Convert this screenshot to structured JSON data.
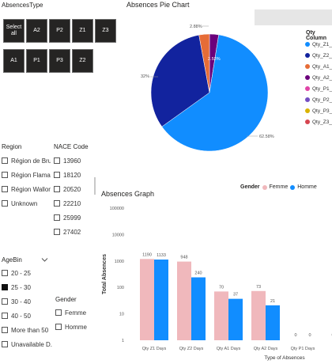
{
  "absences_type": {
    "title": "AbsencesType",
    "tiles_row1": [
      "Select all",
      "A2",
      "P2",
      "Z1",
      "Z3"
    ],
    "tiles_row2": [
      "A1",
      "P1",
      "P3",
      "Z2"
    ]
  },
  "region": {
    "title": "Region",
    "items": [
      {
        "label": "Région de Bru...",
        "checked": false
      },
      {
        "label": "Région Flama...",
        "checked": false
      },
      {
        "label": "Région Wallon...",
        "checked": false
      },
      {
        "label": "Unknown",
        "checked": false
      }
    ]
  },
  "nace": {
    "title": "NACE Code",
    "items": [
      {
        "label": "13960",
        "checked": false
      },
      {
        "label": "18120",
        "checked": false
      },
      {
        "label": "20520",
        "checked": false
      },
      {
        "label": "22210",
        "checked": false
      },
      {
        "label": "25999",
        "checked": false
      },
      {
        "label": "27402",
        "checked": false
      }
    ]
  },
  "agebin": {
    "title": "AgeBin",
    "chevron_icon": "chevron-down-icon",
    "items": [
      {
        "label": "20 - 25",
        "checked": false
      },
      {
        "label": "25 - 30",
        "checked": true
      },
      {
        "label": "30 - 40",
        "checked": false
      },
      {
        "label": "40 - 50",
        "checked": false
      },
      {
        "label": "More than 50",
        "checked": false
      },
      {
        "label": "Unavailable D...",
        "checked": false
      }
    ]
  },
  "gender_slicer": {
    "title": "Gender",
    "items": [
      {
        "label": "Femme",
        "checked": false
      },
      {
        "label": "Homme",
        "checked": false
      }
    ]
  },
  "pie": {
    "title": "Absences Pie Chart",
    "legend_title": "Qty Column",
    "legend_items": [
      {
        "label": "Qty_Z1_Da",
        "color": "#118DFF"
      },
      {
        "label": "Qty_Z2_Da",
        "color": "#12239E"
      },
      {
        "label": "Qty_A1_Da",
        "color": "#E66C37"
      },
      {
        "label": "Qty_A2_Da",
        "color": "#6B007B"
      },
      {
        "label": "Qty_P1_Da",
        "color": "#E044A7"
      },
      {
        "label": "Qty_P2_Da",
        "color": "#744EC2"
      },
      {
        "label": "Qty_P3_Da",
        "color": "#D9B300"
      },
      {
        "label": "Qty_Z3_Da",
        "color": "#D64550"
      }
    ],
    "slice_labels": {
      "z1": "62.58%",
      "z2": "32%",
      "a1": "2.88%",
      "a2": "2.53%"
    }
  },
  "bar": {
    "title": "Absences Graph",
    "legend_title": "Gender",
    "legend": [
      {
        "label": "Femme",
        "color": "#F0B8BC"
      },
      {
        "label": "Homme",
        "color": "#118DFF"
      }
    ]
  },
  "chart_data": [
    {
      "type": "pie",
      "title": "Absences Pie Chart",
      "categories": [
        "Qty_Z1_Days",
        "Qty_Z2_Days",
        "Qty_A1_Days",
        "Qty_A2_Days"
      ],
      "values": [
        62.58,
        32,
        2.88,
        2.53
      ],
      "colors": [
        "#118DFF",
        "#12239E",
        "#E66C37",
        "#6B007B"
      ],
      "legend": "right"
    },
    {
      "type": "bar",
      "title": "Absences Graph",
      "xlabel": "Type of Absences",
      "ylabel": "Total Absences",
      "yscale": "log",
      "ylim": [
        1,
        100000
      ],
      "yticks": [
        "1",
        "10",
        "100",
        "1000",
        "10000",
        "100000"
      ],
      "categories": [
        "Qty Z1 Days",
        "Qty Z2 Days",
        "Qty A1 Days",
        "Qty A2 Days",
        "Qty P1 Days",
        "Qty P"
      ],
      "series": [
        {
          "name": "Femme",
          "color": "#F0B8BC",
          "values": [
            1190,
            948,
            70,
            73,
            0,
            0
          ]
        },
        {
          "name": "Homme",
          "color": "#118DFF",
          "values": [
            1133,
            240,
            37,
            21,
            0,
            0
          ]
        }
      ],
      "legend": "top"
    }
  ]
}
